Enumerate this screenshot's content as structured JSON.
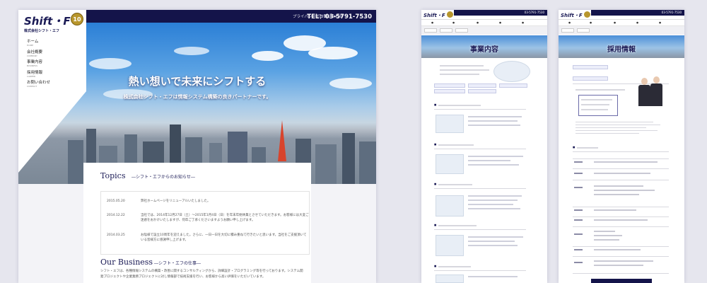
{
  "main": {
    "topbar": {
      "privacy": "プライバシーポリシー",
      "contact": "お問い合わせ",
      "tel": "TEL：03-5791-7530"
    },
    "logo": {
      "text": "Shift・F",
      "anniversary": "10",
      "company": "株式会社シフト・エフ"
    },
    "nav": [
      {
        "jp": "ホーム",
        "en": "HOME"
      },
      {
        "jp": "会社概要",
        "en": "COMPANY"
      },
      {
        "jp": "事業内容",
        "en": "BUSINESS"
      },
      {
        "jp": "採用情報",
        "en": "CAREER"
      },
      {
        "jp": "お問い合わせ",
        "en": "CONTACT"
      }
    ],
    "hero": {
      "title": "熱い想いで未来にシフトする",
      "subtitle": "株式会社シフト・エフは情報システム構築の良きパートナーです。"
    },
    "topics": {
      "title": "Topics",
      "subtitle": "―シフト・エフからのお知らせ―",
      "items": [
        {
          "date": "2015.05.20",
          "text": "弊社ホームページをリニューアルいたしました。"
        },
        {
          "date": "2014.12.22",
          "text": "当社では、2014年12月27日（土）～2015年1月4日（日）を年末年始休業とさせていただきます。お客様には大変ご迷惑をおかけいたしますが、何卒ご了承くださいますようお願い申し上げます。"
        },
        {
          "date": "2014.03.25",
          "text": "お陰様で設立10周年を迎えました。さらに、一日一日を大切に積み重ねて行きたいと思います。当社をご支援頂いている皆様方に感謝申し上げます。"
        }
      ]
    },
    "business": {
      "title": "Our Business",
      "subtitle": "―シフト・エフの仕事―",
      "text": "シフト・エフは、各種情報システムの構築・改善に関するコンサルティングから、詳細設計・プログラミング等を行っております。システム開発プロジェクトや企業業務プロジェクトに対し情報部で技術支援を行い、お客様から高い評価をいただいています。"
    }
  },
  "business_page": {
    "logo": "Shift・F",
    "tel": "03-5791-7530",
    "banner_title": "事業内容"
  },
  "career_page": {
    "logo": "Shift・F",
    "tel": "03-5791-7530",
    "banner_title": "採用情報"
  },
  "colors": {
    "navy": "#14144a",
    "gold": "#b8962c",
    "sky": "#2b7fd6"
  }
}
